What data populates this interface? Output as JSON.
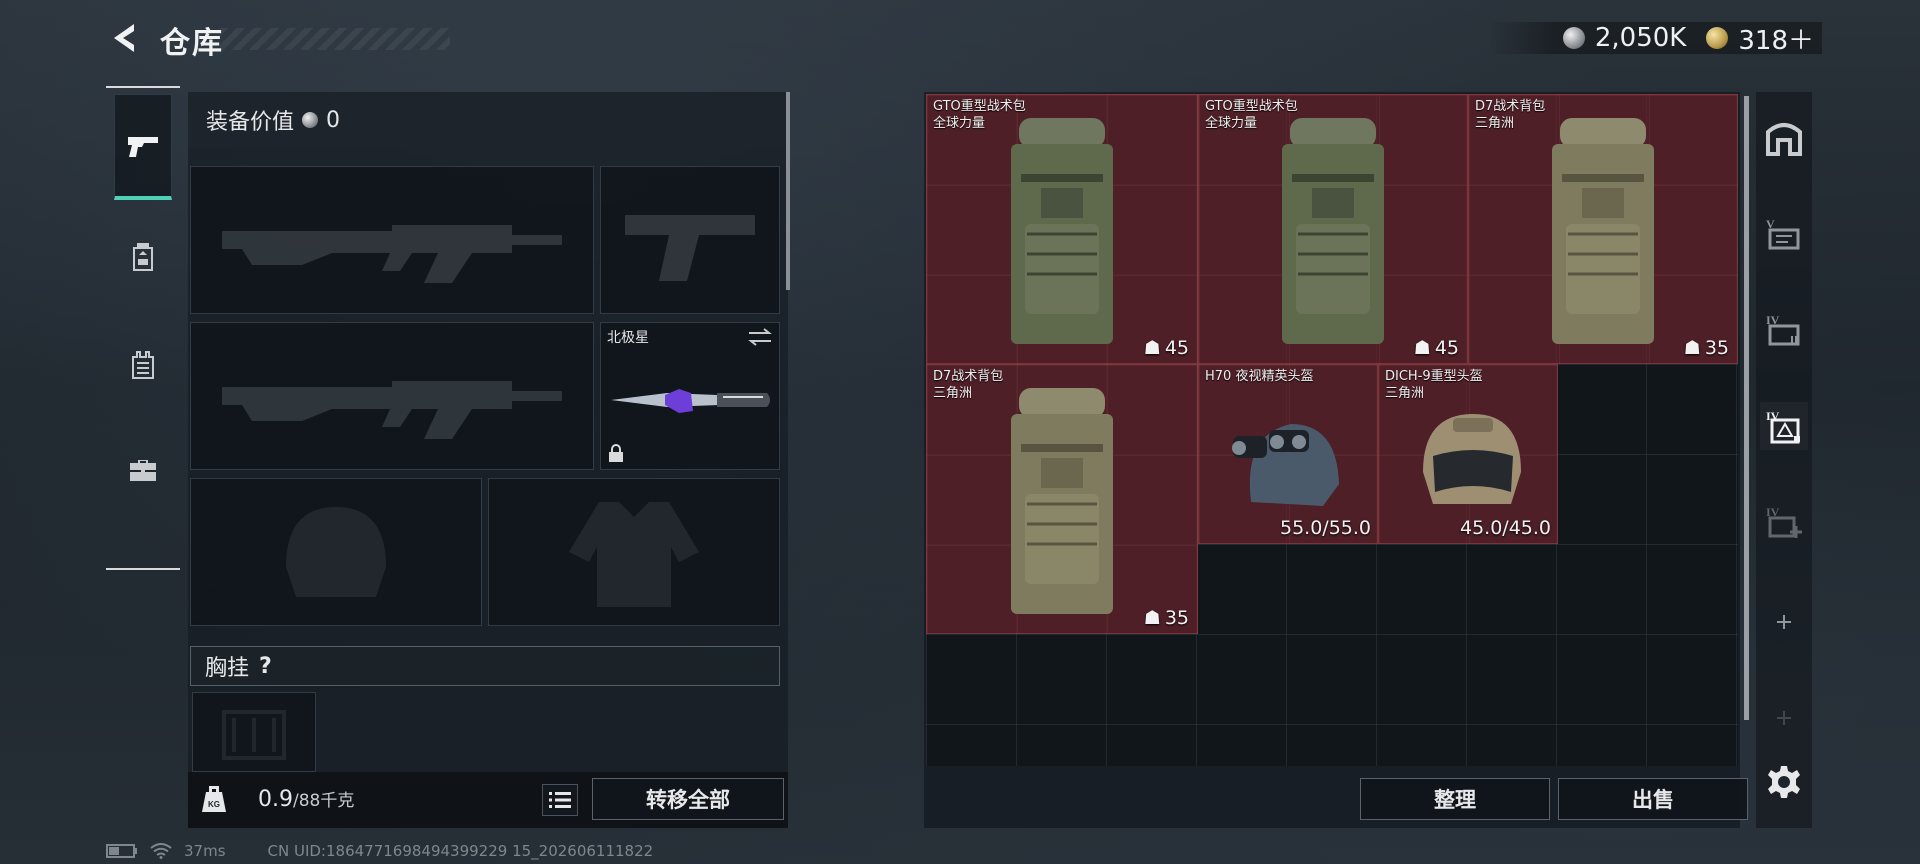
{
  "header": {
    "title": "仓库",
    "currency_silver": "2,050K",
    "currency_gold": "318＋"
  },
  "left_nav": {
    "items": [
      "pistol-icon",
      "backpack-icon",
      "vest-icon",
      "toolbox-icon"
    ],
    "active": "pistol-icon"
  },
  "equipment": {
    "value_label": "装备价值",
    "value": "0",
    "knife_name": "北极星",
    "chest_rig_label": "胸挂",
    "chest_rig_help": "?"
  },
  "weight": {
    "current": "0.9",
    "max": "/88千克"
  },
  "buttons": {
    "transfer_all": "转移全部",
    "sort": "整理",
    "sell": "出售"
  },
  "storage": {
    "items": [
      {
        "name": "GTO重型战术包",
        "sub": "全球力量",
        "qty": "45",
        "kind": "backpack"
      },
      {
        "name": "GTO重型战术包",
        "sub": "全球力量",
        "qty": "45",
        "kind": "backpack"
      },
      {
        "name": "D7战术背包",
        "sub": "三角洲",
        "qty": "35",
        "kind": "backpack"
      },
      {
        "name": "D7战术背包",
        "sub": "三角洲",
        "qty": "35",
        "kind": "backpack"
      },
      {
        "name": "H70 夜视精英头盔",
        "sub": "",
        "durability": "55.0/55.0",
        "kind": "helmet"
      },
      {
        "name": "DICH-9重型头盔",
        "sub": "三角洲",
        "durability": "45.0/45.0",
        "kind": "helmet"
      }
    ]
  },
  "right_tabs": [
    "vault-icon",
    "storage-v-icon",
    "storage-iv-a-icon",
    "storage-iv-b-icon",
    "storage-iv-add-icon",
    "plus-icon",
    "plus-icon-dim",
    "settings-icon"
  ],
  "footer": {
    "ping": "37ms",
    "uid": "CN UID:1864771698494399229 15_202606111822"
  },
  "colors": {
    "accent": "#4fd1b8",
    "item_bg": "#60222a"
  }
}
